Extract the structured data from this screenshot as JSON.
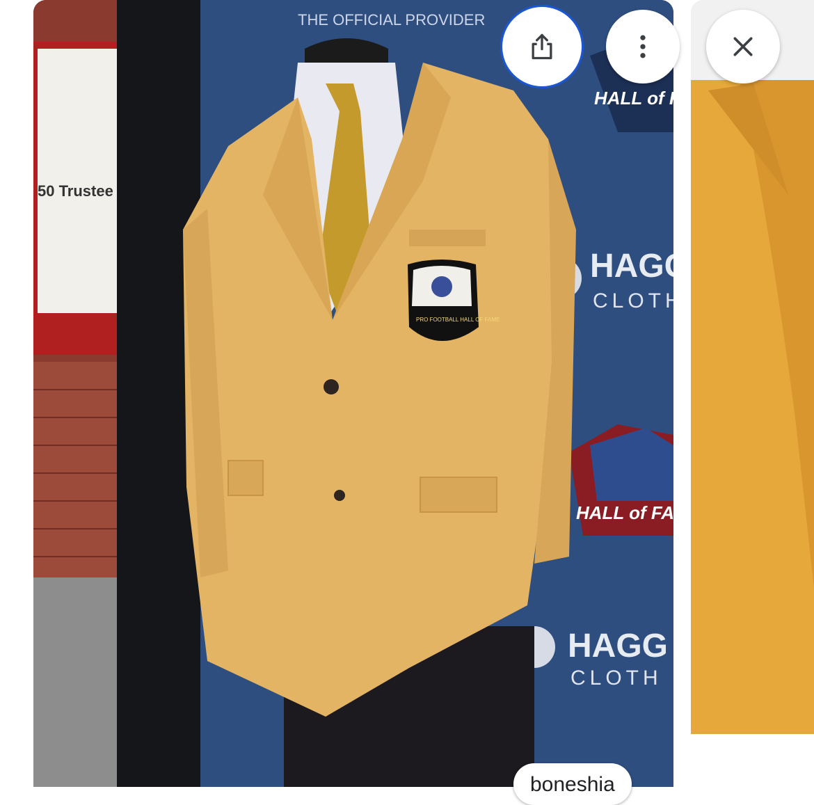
{
  "viewer": {
    "image_alt": "Gold Pro Football Hall of Fame jacket on a mannequin",
    "source_chip_label": "boneshia",
    "actions": {
      "share_icon": "share-icon",
      "more_icon": "more-vert-icon",
      "close_icon": "close-icon"
    }
  },
  "scene_text": {
    "banner_top": "THE OFFICIAL PROVIDER",
    "hall_of_fame": "HALL of FAME",
    "haggar": "HAGG",
    "clothing": "CLOTH",
    "trustee_sign": "50 Trustee",
    "patch_label": "PRO FOOTBALL HALL OF FAME"
  },
  "colors": {
    "jacket_gold": "#e3b463",
    "backdrop_blue": "#2f4e80",
    "focus_ring": "#1a56d6"
  }
}
